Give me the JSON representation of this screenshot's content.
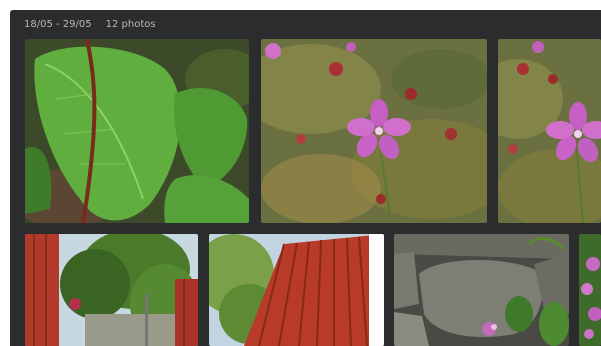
{
  "header": {
    "date_range": "18/05 - 29/05",
    "photo_count": "12 photos"
  },
  "photos": [
    {
      "subject": "green leaves"
    },
    {
      "subject": "pink flower"
    },
    {
      "subject": "pink flower"
    },
    {
      "subject": "red fence"
    },
    {
      "subject": "red fence"
    },
    {
      "subject": "stones with flowers"
    },
    {
      "subject": "pink flowers"
    }
  ],
  "colors": {
    "background": "#2b2c2e",
    "header_text": "#b8b8b8"
  }
}
